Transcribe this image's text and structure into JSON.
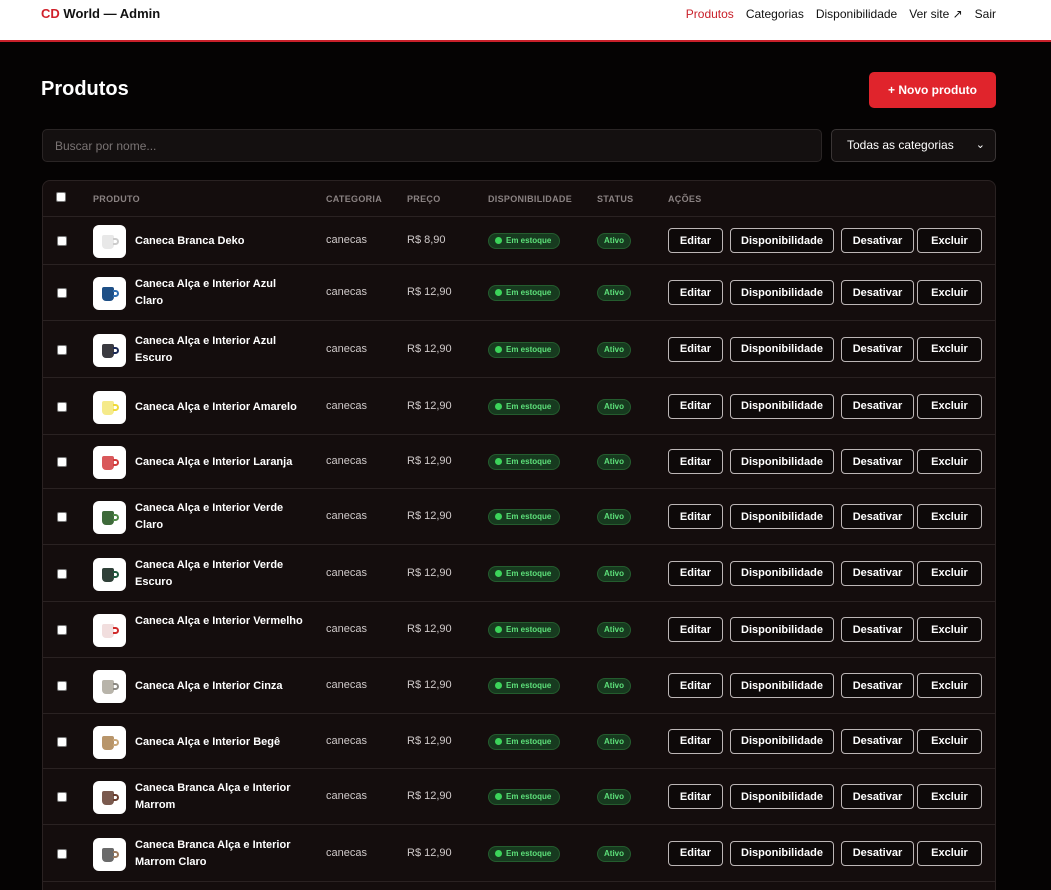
{
  "header": {
    "brand_prefix": "CD",
    "brand_rest": "World — Admin",
    "nav": [
      "Produtos",
      "Categorias",
      "Disponibilidade",
      "Ver site ↗",
      "Sair"
    ]
  },
  "page": {
    "title": "Produtos",
    "new_button": "+ Novo produto",
    "search_placeholder": "Buscar por nome...",
    "category_filter": "Todas as categorias"
  },
  "table": {
    "columns": [
      "PRODUTO",
      "CATEGORIA",
      "PREÇO",
      "DISPONIBILIDADE",
      "STATUS",
      "AÇÕES"
    ],
    "actions": [
      "Editar",
      "Disponibilidade",
      "Desativar",
      "Excluir"
    ],
    "rows": [
      {
        "name": "Caneca Branca Deko",
        "category": "canecas",
        "price": "R$ 8,90",
        "availability": "Em estoque",
        "status": "Ativo",
        "mug_color": "#e8e8e8",
        "handle_color": "#cccccc"
      },
      {
        "name": "Caneca Alça e Interior Azul Claro",
        "category": "canecas",
        "price": "R$ 12,90",
        "availability": "Em estoque",
        "status": "Ativo",
        "mug_color": "#1e4f86",
        "handle_color": "#2f6fb3"
      },
      {
        "name": "Caneca Alça e Interior Azul Escuro",
        "category": "canecas",
        "price": "R$ 12,90",
        "availability": "Em estoque",
        "status": "Ativo",
        "mug_color": "#3a3a40",
        "handle_color": "#1b2a57"
      },
      {
        "name": "Caneca Alça e Interior Amarelo",
        "category": "canecas",
        "price": "R$ 12,90",
        "availability": "Em estoque",
        "status": "Ativo",
        "mug_color": "#f5ea8a",
        "handle_color": "#efd93a"
      },
      {
        "name": "Caneca Alça e Interior Laranja",
        "category": "canecas",
        "price": "R$ 12,90",
        "availability": "Em estoque",
        "status": "Ativo",
        "mug_color": "#d9585a",
        "handle_color": "#d23a3a"
      },
      {
        "name": "Caneca Alça e Interior Verde Claro",
        "category": "canecas",
        "price": "R$ 12,90",
        "availability": "Em estoque",
        "status": "Ativo",
        "mug_color": "#3e6a3a",
        "handle_color": "#4f8a45"
      },
      {
        "name": "Caneca Alça e Interior Verde Escuro",
        "category": "canecas",
        "price": "R$ 12,90",
        "availability": "Em estoque",
        "status": "Ativo",
        "mug_color": "#2f4038",
        "handle_color": "#1e5a3e"
      },
      {
        "name": "Caneca Alça e Interior Vermelho",
        "category": "canecas",
        "price": "R$ 12,90",
        "availability": "Em estoque",
        "status": "Ativo",
        "mug_color": "#f1dede",
        "handle_color": "#d02a2a"
      },
      {
        "name": "Caneca Alça e Interior Cinza",
        "category": "canecas",
        "price": "R$ 12,90",
        "availability": "Em estoque",
        "status": "Ativo",
        "mug_color": "#b8b4aa",
        "handle_color": "#8c8a84"
      },
      {
        "name": "Caneca Alça e Interior Begê",
        "category": "canecas",
        "price": "R$ 12,90",
        "availability": "Em estoque",
        "status": "Ativo",
        "mug_color": "#b8956a",
        "handle_color": "#c9a77a"
      },
      {
        "name": "Caneca Branca Alça e Interior Marrom",
        "category": "canecas",
        "price": "R$ 12,90",
        "availability": "Em estoque",
        "status": "Ativo",
        "mug_color": "#7a5a4e",
        "handle_color": "#6a3e2e"
      },
      {
        "name": "Caneca Branca Alça e Interior Marrom Claro",
        "category": "canecas",
        "price": "R$ 12,90",
        "availability": "Em estoque",
        "status": "Ativo",
        "mug_color": "#6a6a6a",
        "handle_color": "#9a7a5e"
      }
    ]
  }
}
